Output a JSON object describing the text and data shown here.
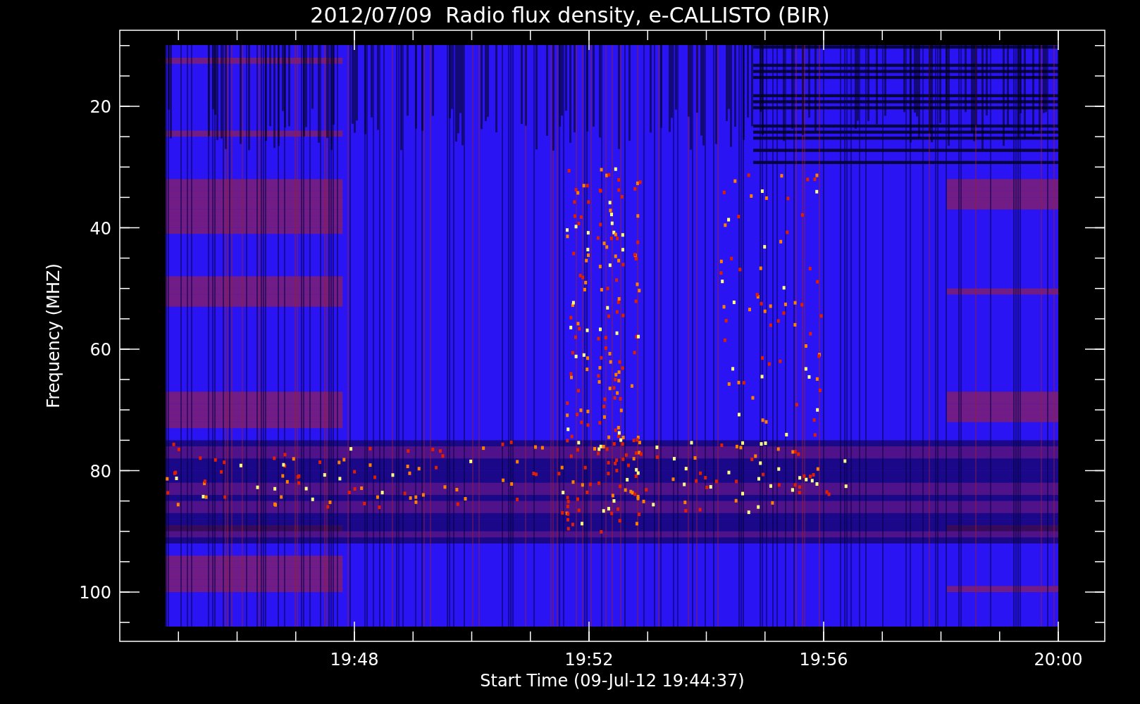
{
  "title": "2012/07/09  Radio flux density, e-CALLISTO (BIR)",
  "plot": {
    "y_axis": {
      "label": "Frequency (MHZ)",
      "ticks": [
        "20",
        "40",
        "60",
        "80",
        "100"
      ]
    },
    "x_axis": {
      "label": "Start Time (09-Jul-12 19:44:37)",
      "ticks": [
        "19:48",
        "19:52",
        "19:56",
        "20:00"
      ]
    }
  }
}
